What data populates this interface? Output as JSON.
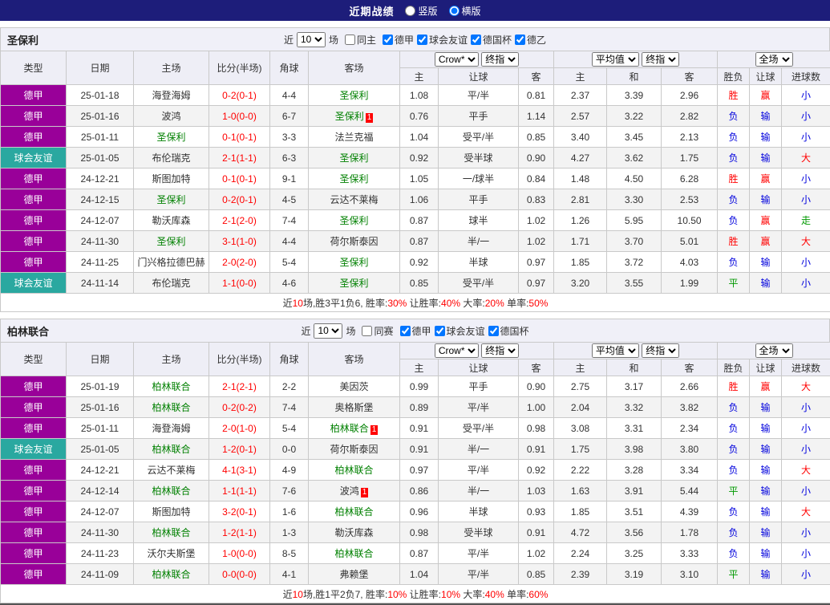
{
  "topbar": {
    "title": "近期战绩",
    "vertical_label": "竖版",
    "horizontal_label": "横版",
    "selected": "横版"
  },
  "table_header": {
    "type": "类型",
    "date": "日期",
    "home": "主场",
    "score": "比分(半场)",
    "corner": "角球",
    "away": "客场",
    "odds_group1": {
      "select1": "Crow*",
      "select2": "终指"
    },
    "odds_group2": {
      "select1": "平均值",
      "select2": "终指"
    },
    "odds_group3": {
      "select1": "全场"
    },
    "sub": [
      "主",
      "让球",
      "客",
      "主",
      "和",
      "客",
      "胜负",
      "让球",
      "进球数"
    ]
  },
  "colors": {
    "league_bg": {
      "德甲": "#990099",
      "球会友谊": "#2aa8a0"
    },
    "value_text": {
      "胜": "#ff0000",
      "赢": "#ff0000",
      "大": "#ff0000",
      "负": "#0000dd",
      "输": "#0000dd",
      "小": "#0000dd",
      "平": "#009900",
      "走": "#009900"
    },
    "self_team": "#008000",
    "score": "#ff0000",
    "red_card_bg": "#ff0000"
  },
  "sections": [
    {
      "team": "圣保利",
      "filter": {
        "near": "近",
        "count": "10",
        "games": "场",
        "same": "同主",
        "same_checked": false,
        "leagues": [
          "德甲",
          "球会友谊",
          "德国杯",
          "德乙"
        ]
      },
      "rows": [
        {
          "league": "德甲",
          "date": "25-01-18",
          "home": "海登海姆",
          "home_self": false,
          "home_red": 0,
          "score": "0-2(0-1)",
          "corner": "4-4",
          "away": "圣保利",
          "away_self": true,
          "away_red": 0,
          "odds1": [
            "1.08",
            "平/半",
            "0.81"
          ],
          "avg": [
            "2.37",
            "3.39",
            "2.96"
          ],
          "result": "胜",
          "handicap": "赢",
          "goals": "小"
        },
        {
          "league": "德甲",
          "date": "25-01-16",
          "home": "波鸿",
          "home_self": false,
          "home_red": 0,
          "score": "1-0(0-0)",
          "corner": "6-7",
          "away": "圣保利",
          "away_self": true,
          "away_red": 1,
          "odds1": [
            "0.76",
            "平手",
            "1.14"
          ],
          "avg": [
            "2.57",
            "3.22",
            "2.82"
          ],
          "result": "负",
          "handicap": "输",
          "goals": "小"
        },
        {
          "league": "德甲",
          "date": "25-01-11",
          "home": "圣保利",
          "home_self": true,
          "home_red": 0,
          "score": "0-1(0-1)",
          "corner": "3-3",
          "away": "法兰克福",
          "away_self": false,
          "away_red": 0,
          "odds1": [
            "1.04",
            "受平/半",
            "0.85"
          ],
          "avg": [
            "3.40",
            "3.45",
            "2.13"
          ],
          "result": "负",
          "handicap": "输",
          "goals": "小"
        },
        {
          "league": "球会友谊",
          "date": "25-01-05",
          "home": "布伦瑞克",
          "home_self": false,
          "home_red": 0,
          "score": "2-1(1-1)",
          "corner": "6-3",
          "away": "圣保利",
          "away_self": true,
          "away_red": 0,
          "odds1": [
            "0.92",
            "受半球",
            "0.90"
          ],
          "avg": [
            "4.27",
            "3.62",
            "1.75"
          ],
          "result": "负",
          "handicap": "输",
          "goals": "大"
        },
        {
          "league": "德甲",
          "date": "24-12-21",
          "home": "斯图加特",
          "home_self": false,
          "home_red": 0,
          "score": "0-1(0-1)",
          "corner": "9-1",
          "away": "圣保利",
          "away_self": true,
          "away_red": 0,
          "odds1": [
            "1.05",
            "一/球半",
            "0.84"
          ],
          "avg": [
            "1.48",
            "4.50",
            "6.28"
          ],
          "result": "胜",
          "handicap": "赢",
          "goals": "小"
        },
        {
          "league": "德甲",
          "date": "24-12-15",
          "home": "圣保利",
          "home_self": true,
          "home_red": 0,
          "score": "0-2(0-1)",
          "corner": "4-5",
          "away": "云达不莱梅",
          "away_self": false,
          "away_red": 0,
          "odds1": [
            "1.06",
            "平手",
            "0.83"
          ],
          "avg": [
            "2.81",
            "3.30",
            "2.53"
          ],
          "result": "负",
          "handicap": "输",
          "goals": "小"
        },
        {
          "league": "德甲",
          "date": "24-12-07",
          "home": "勒沃库森",
          "home_self": false,
          "home_red": 0,
          "score": "2-1(2-0)",
          "corner": "7-4",
          "away": "圣保利",
          "away_self": true,
          "away_red": 0,
          "odds1": [
            "0.87",
            "球半",
            "1.02"
          ],
          "avg": [
            "1.26",
            "5.95",
            "10.50"
          ],
          "result": "负",
          "handicap": "赢",
          "goals": "走"
        },
        {
          "league": "德甲",
          "date": "24-11-30",
          "home": "圣保利",
          "home_self": true,
          "home_red": 0,
          "score": "3-1(1-0)",
          "corner": "4-4",
          "away": "荷尔斯泰因",
          "away_self": false,
          "away_red": 0,
          "odds1": [
            "0.87",
            "半/一",
            "1.02"
          ],
          "avg": [
            "1.71",
            "3.70",
            "5.01"
          ],
          "result": "胜",
          "handicap": "赢",
          "goals": "大"
        },
        {
          "league": "德甲",
          "date": "24-11-25",
          "home": "门兴格拉德巴赫",
          "home_self": false,
          "home_red": 0,
          "score": "2-0(2-0)",
          "corner": "5-4",
          "away": "圣保利",
          "away_self": true,
          "away_red": 0,
          "odds1": [
            "0.92",
            "半球",
            "0.97"
          ],
          "avg": [
            "1.85",
            "3.72",
            "4.03"
          ],
          "result": "负",
          "handicap": "输",
          "goals": "小"
        },
        {
          "league": "球会友谊",
          "date": "24-11-14",
          "home": "布伦瑞克",
          "home_self": false,
          "home_red": 0,
          "score": "1-1(0-0)",
          "corner": "4-6",
          "away": "圣保利",
          "away_self": true,
          "away_red": 0,
          "odds1": [
            "0.85",
            "受平/半",
            "0.97"
          ],
          "avg": [
            "3.20",
            "3.55",
            "1.99"
          ],
          "result": "平",
          "handicap": "输",
          "goals": "小"
        }
      ],
      "summary": [
        {
          "text": "近",
          "red": false
        },
        {
          "text": "10",
          "red": true
        },
        {
          "text": "场,胜3平1负6, 胜率:",
          "red": false
        },
        {
          "text": "30%",
          "red": true
        },
        {
          "text": " 让胜率:",
          "red": false
        },
        {
          "text": "40%",
          "red": true
        },
        {
          "text": " 大率:",
          "red": false
        },
        {
          "text": "20%",
          "red": true
        },
        {
          "text": " 单率:",
          "red": false
        },
        {
          "text": "50%",
          "red": true
        }
      ]
    },
    {
      "team": "柏林联合",
      "filter": {
        "near": "近",
        "count": "10",
        "games": "场",
        "same": "同赛",
        "same_checked": false,
        "leagues": [
          "德甲",
          "球会友谊",
          "德国杯"
        ]
      },
      "rows": [
        {
          "league": "德甲",
          "date": "25-01-19",
          "home": "柏林联合",
          "home_self": true,
          "home_red": 0,
          "score": "2-1(2-1)",
          "corner": "2-2",
          "away": "美因茨",
          "away_self": false,
          "away_red": 0,
          "odds1": [
            "0.99",
            "平手",
            "0.90"
          ],
          "avg": [
            "2.75",
            "3.17",
            "2.66"
          ],
          "result": "胜",
          "handicap": "赢",
          "goals": "大"
        },
        {
          "league": "德甲",
          "date": "25-01-16",
          "home": "柏林联合",
          "home_self": true,
          "home_red": 0,
          "score": "0-2(0-2)",
          "corner": "7-4",
          "away": "奥格斯堡",
          "away_self": false,
          "away_red": 0,
          "odds1": [
            "0.89",
            "平/半",
            "1.00"
          ],
          "avg": [
            "2.04",
            "3.32",
            "3.82"
          ],
          "result": "负",
          "handicap": "输",
          "goals": "小"
        },
        {
          "league": "德甲",
          "date": "25-01-11",
          "home": "海登海姆",
          "home_self": false,
          "home_red": 0,
          "score": "2-0(1-0)",
          "corner": "5-4",
          "away": "柏林联合",
          "away_self": true,
          "away_red": 1,
          "odds1": [
            "0.91",
            "受平/半",
            "0.98"
          ],
          "avg": [
            "3.08",
            "3.31",
            "2.34"
          ],
          "result": "负",
          "handicap": "输",
          "goals": "小"
        },
        {
          "league": "球会友谊",
          "date": "25-01-05",
          "home": "柏林联合",
          "home_self": true,
          "home_red": 0,
          "score": "1-2(0-1)",
          "corner": "0-0",
          "away": "荷尔斯泰因",
          "away_self": false,
          "away_red": 0,
          "odds1": [
            "0.91",
            "半/一",
            "0.91"
          ],
          "avg": [
            "1.75",
            "3.98",
            "3.80"
          ],
          "result": "负",
          "handicap": "输",
          "goals": "小"
        },
        {
          "league": "德甲",
          "date": "24-12-21",
          "home": "云达不莱梅",
          "home_self": false,
          "home_red": 0,
          "score": "4-1(3-1)",
          "corner": "4-9",
          "away": "柏林联合",
          "away_self": true,
          "away_red": 0,
          "odds1": [
            "0.97",
            "平/半",
            "0.92"
          ],
          "avg": [
            "2.22",
            "3.28",
            "3.34"
          ],
          "result": "负",
          "handicap": "输",
          "goals": "大"
        },
        {
          "league": "德甲",
          "date": "24-12-14",
          "home": "柏林联合",
          "home_self": true,
          "home_red": 0,
          "score": "1-1(1-1)",
          "corner": "7-6",
          "away": "波鸿",
          "away_self": false,
          "away_red": 1,
          "odds1": [
            "0.86",
            "半/一",
            "1.03"
          ],
          "avg": [
            "1.63",
            "3.91",
            "5.44"
          ],
          "result": "平",
          "handicap": "输",
          "goals": "小"
        },
        {
          "league": "德甲",
          "date": "24-12-07",
          "home": "斯图加特",
          "home_self": false,
          "home_red": 0,
          "score": "3-2(0-1)",
          "corner": "1-6",
          "away": "柏林联合",
          "away_self": true,
          "away_red": 0,
          "odds1": [
            "0.96",
            "半球",
            "0.93"
          ],
          "avg": [
            "1.85",
            "3.51",
            "4.39"
          ],
          "result": "负",
          "handicap": "输",
          "goals": "大"
        },
        {
          "league": "德甲",
          "date": "24-11-30",
          "home": "柏林联合",
          "home_self": true,
          "home_red": 0,
          "score": "1-2(1-1)",
          "corner": "1-3",
          "away": "勒沃库森",
          "away_self": false,
          "away_red": 0,
          "odds1": [
            "0.98",
            "受半球",
            "0.91"
          ],
          "avg": [
            "4.72",
            "3.56",
            "1.78"
          ],
          "result": "负",
          "handicap": "输",
          "goals": "小"
        },
        {
          "league": "德甲",
          "date": "24-11-23",
          "home": "沃尔夫斯堡",
          "home_self": false,
          "home_red": 0,
          "score": "1-0(0-0)",
          "corner": "8-5",
          "away": "柏林联合",
          "away_self": true,
          "away_red": 0,
          "odds1": [
            "0.87",
            "平/半",
            "1.02"
          ],
          "avg": [
            "2.24",
            "3.25",
            "3.33"
          ],
          "result": "负",
          "handicap": "输",
          "goals": "小"
        },
        {
          "league": "德甲",
          "date": "24-11-09",
          "home": "柏林联合",
          "home_self": true,
          "home_red": 0,
          "score": "0-0(0-0)",
          "corner": "4-1",
          "away": "弗赖堡",
          "away_self": false,
          "away_red": 0,
          "odds1": [
            "1.04",
            "平/半",
            "0.85"
          ],
          "avg": [
            "2.39",
            "3.19",
            "3.10"
          ],
          "result": "平",
          "handicap": "输",
          "goals": "小"
        }
      ],
      "summary": [
        {
          "text": "近",
          "red": false
        },
        {
          "text": "10",
          "red": true
        },
        {
          "text": "场,胜1平2负7, 胜率:",
          "red": false
        },
        {
          "text": "10%",
          "red": true
        },
        {
          "text": " 让胜率:",
          "red": false
        },
        {
          "text": "10%",
          "red": true
        },
        {
          "text": " 大率:",
          "red": false
        },
        {
          "text": "40%",
          "red": true
        },
        {
          "text": " 单率:",
          "red": false
        },
        {
          "text": "60%",
          "red": true
        }
      ]
    }
  ]
}
